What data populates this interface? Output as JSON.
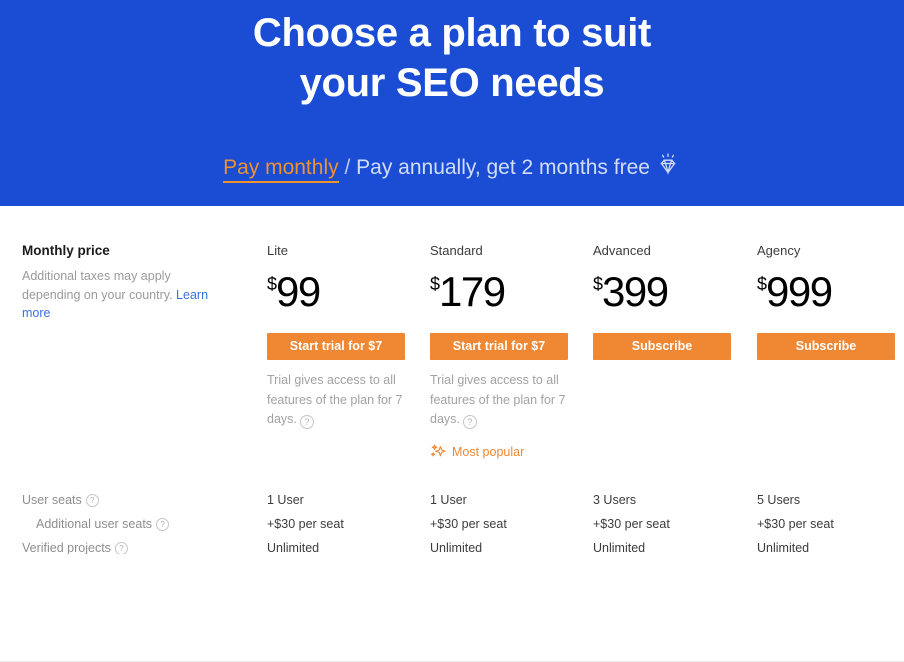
{
  "hero": {
    "title_line1": "Choose a plan to suit",
    "title_line2": "your SEO needs",
    "billing_monthly": "Pay monthly",
    "billing_separator": "/",
    "billing_annual": "Pay annually, get 2 months free",
    "gem_icon": "gem-sparkle-icon",
    "background_color": "#1a4dd4",
    "accent_color": "#f0912f"
  },
  "intro": {
    "title": "Monthly price",
    "note": "Additional taxes may apply depending on your country. ",
    "link_label": "Learn more"
  },
  "plans": [
    {
      "name": "Lite",
      "currency": "$",
      "amount": "99",
      "cta_label": "Start trial for $7",
      "trial_note": "Trial gives access to all features of the plan for 7 days.",
      "badge": null
    },
    {
      "name": "Standard",
      "currency": "$",
      "amount": "179",
      "cta_label": "Start trial for $7",
      "trial_note": "Trial gives access to all features of the plan for 7 days.",
      "badge": "Most popular"
    },
    {
      "name": "Advanced",
      "currency": "$",
      "amount": "399",
      "cta_label": "Subscribe",
      "trial_note": null,
      "badge": null
    },
    {
      "name": "Agency",
      "currency": "$",
      "amount": "999",
      "cta_label": "Subscribe",
      "trial_note": null,
      "badge": null
    }
  ],
  "features": [
    {
      "label": "User seats",
      "indent": false,
      "has_help": true,
      "values": [
        "1 User",
        "1 User",
        "3 Users",
        "5 Users"
      ]
    },
    {
      "label": "Additional user seats",
      "indent": true,
      "has_help": true,
      "values": [
        "+$30 per seat",
        "+$30 per seat",
        "+$30 per seat",
        "+$30 per seat"
      ]
    },
    {
      "label": "Verified projects",
      "indent": false,
      "has_help": true,
      "values": [
        "Unlimited",
        "Unlimited",
        "Unlimited",
        "Unlimited"
      ]
    }
  ],
  "icons": {
    "help": "?",
    "sparkles": "sparkles-icon"
  },
  "colors": {
    "brand_blue": "#1a4dd4",
    "cta_orange": "#ef8733",
    "link_blue": "#3b6fe0",
    "muted_text": "#9a9a9a"
  }
}
